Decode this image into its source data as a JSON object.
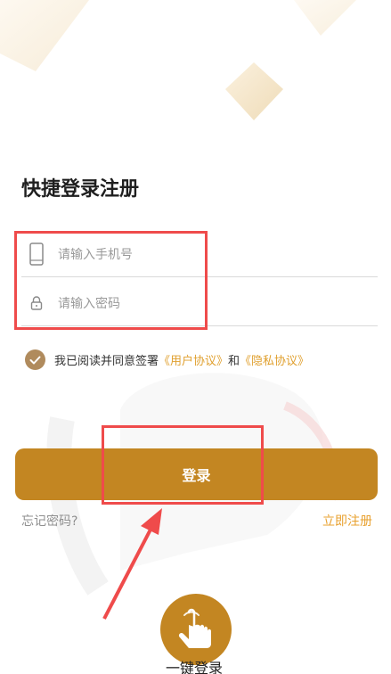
{
  "page": {
    "title": "快捷登录注册"
  },
  "form": {
    "phone_placeholder": "请输入手机号",
    "password_placeholder": "请输入密码"
  },
  "agreement": {
    "prefix": "我已阅读并同意签署",
    "user_agreement": "《用户协议》",
    "conjunction": "和",
    "privacy_agreement": "《隐私协议》",
    "checked": true
  },
  "actions": {
    "login_label": "登录",
    "forgot_label": "忘记密码?",
    "register_label": "立即注册",
    "onekey_label": "一键登录"
  },
  "colors": {
    "accent": "#c38622",
    "link": "#e0a02f",
    "checkbox": "#b08b5d",
    "annotation": "#ef4b4b"
  },
  "icons": {
    "phone": "phone-icon",
    "lock": "lock-icon",
    "check": "check-icon",
    "tap": "tap-hand-icon"
  }
}
